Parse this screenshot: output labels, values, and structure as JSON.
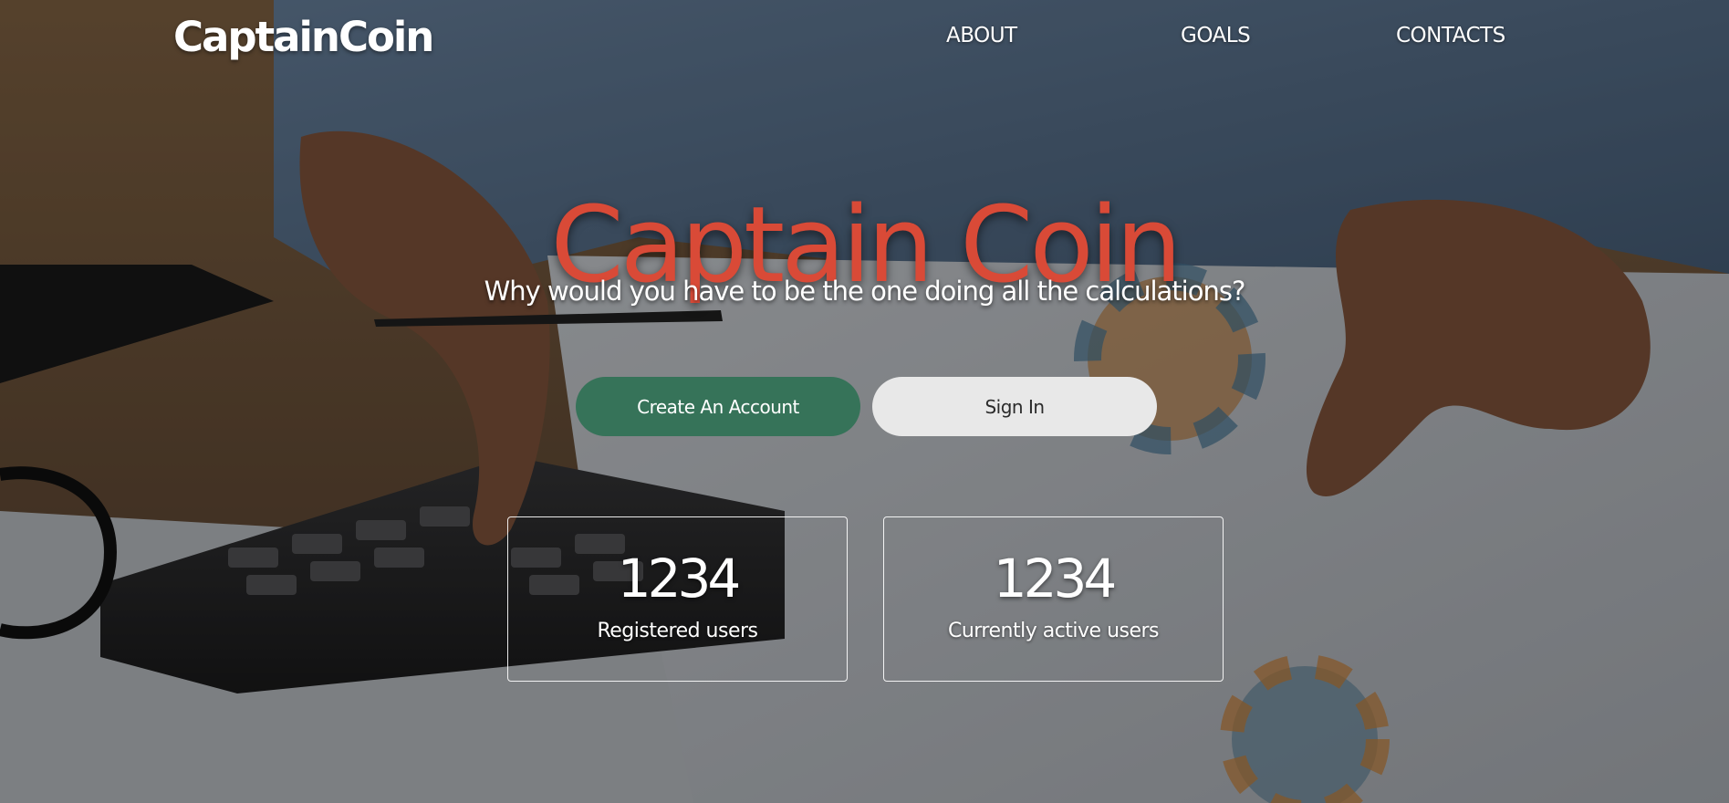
{
  "header": {
    "logo": "CaptainCoin",
    "nav": {
      "about": "ABOUT",
      "goals": "GOALS",
      "contacts": "CONTACTS"
    }
  },
  "hero": {
    "title": "Captain Coin",
    "subtitle": "Why would you have to be the one doing all the calculations?",
    "buttons": {
      "create_account": "Create An Account",
      "sign_in": "Sign In"
    }
  },
  "stats": [
    {
      "value": "1234",
      "label": "Registered users"
    },
    {
      "value": "1234",
      "label": "Currently active users"
    }
  ],
  "colors": {
    "title": "#d94a37",
    "primary_button": "#367359",
    "secondary_button": "#e8e8e8"
  }
}
